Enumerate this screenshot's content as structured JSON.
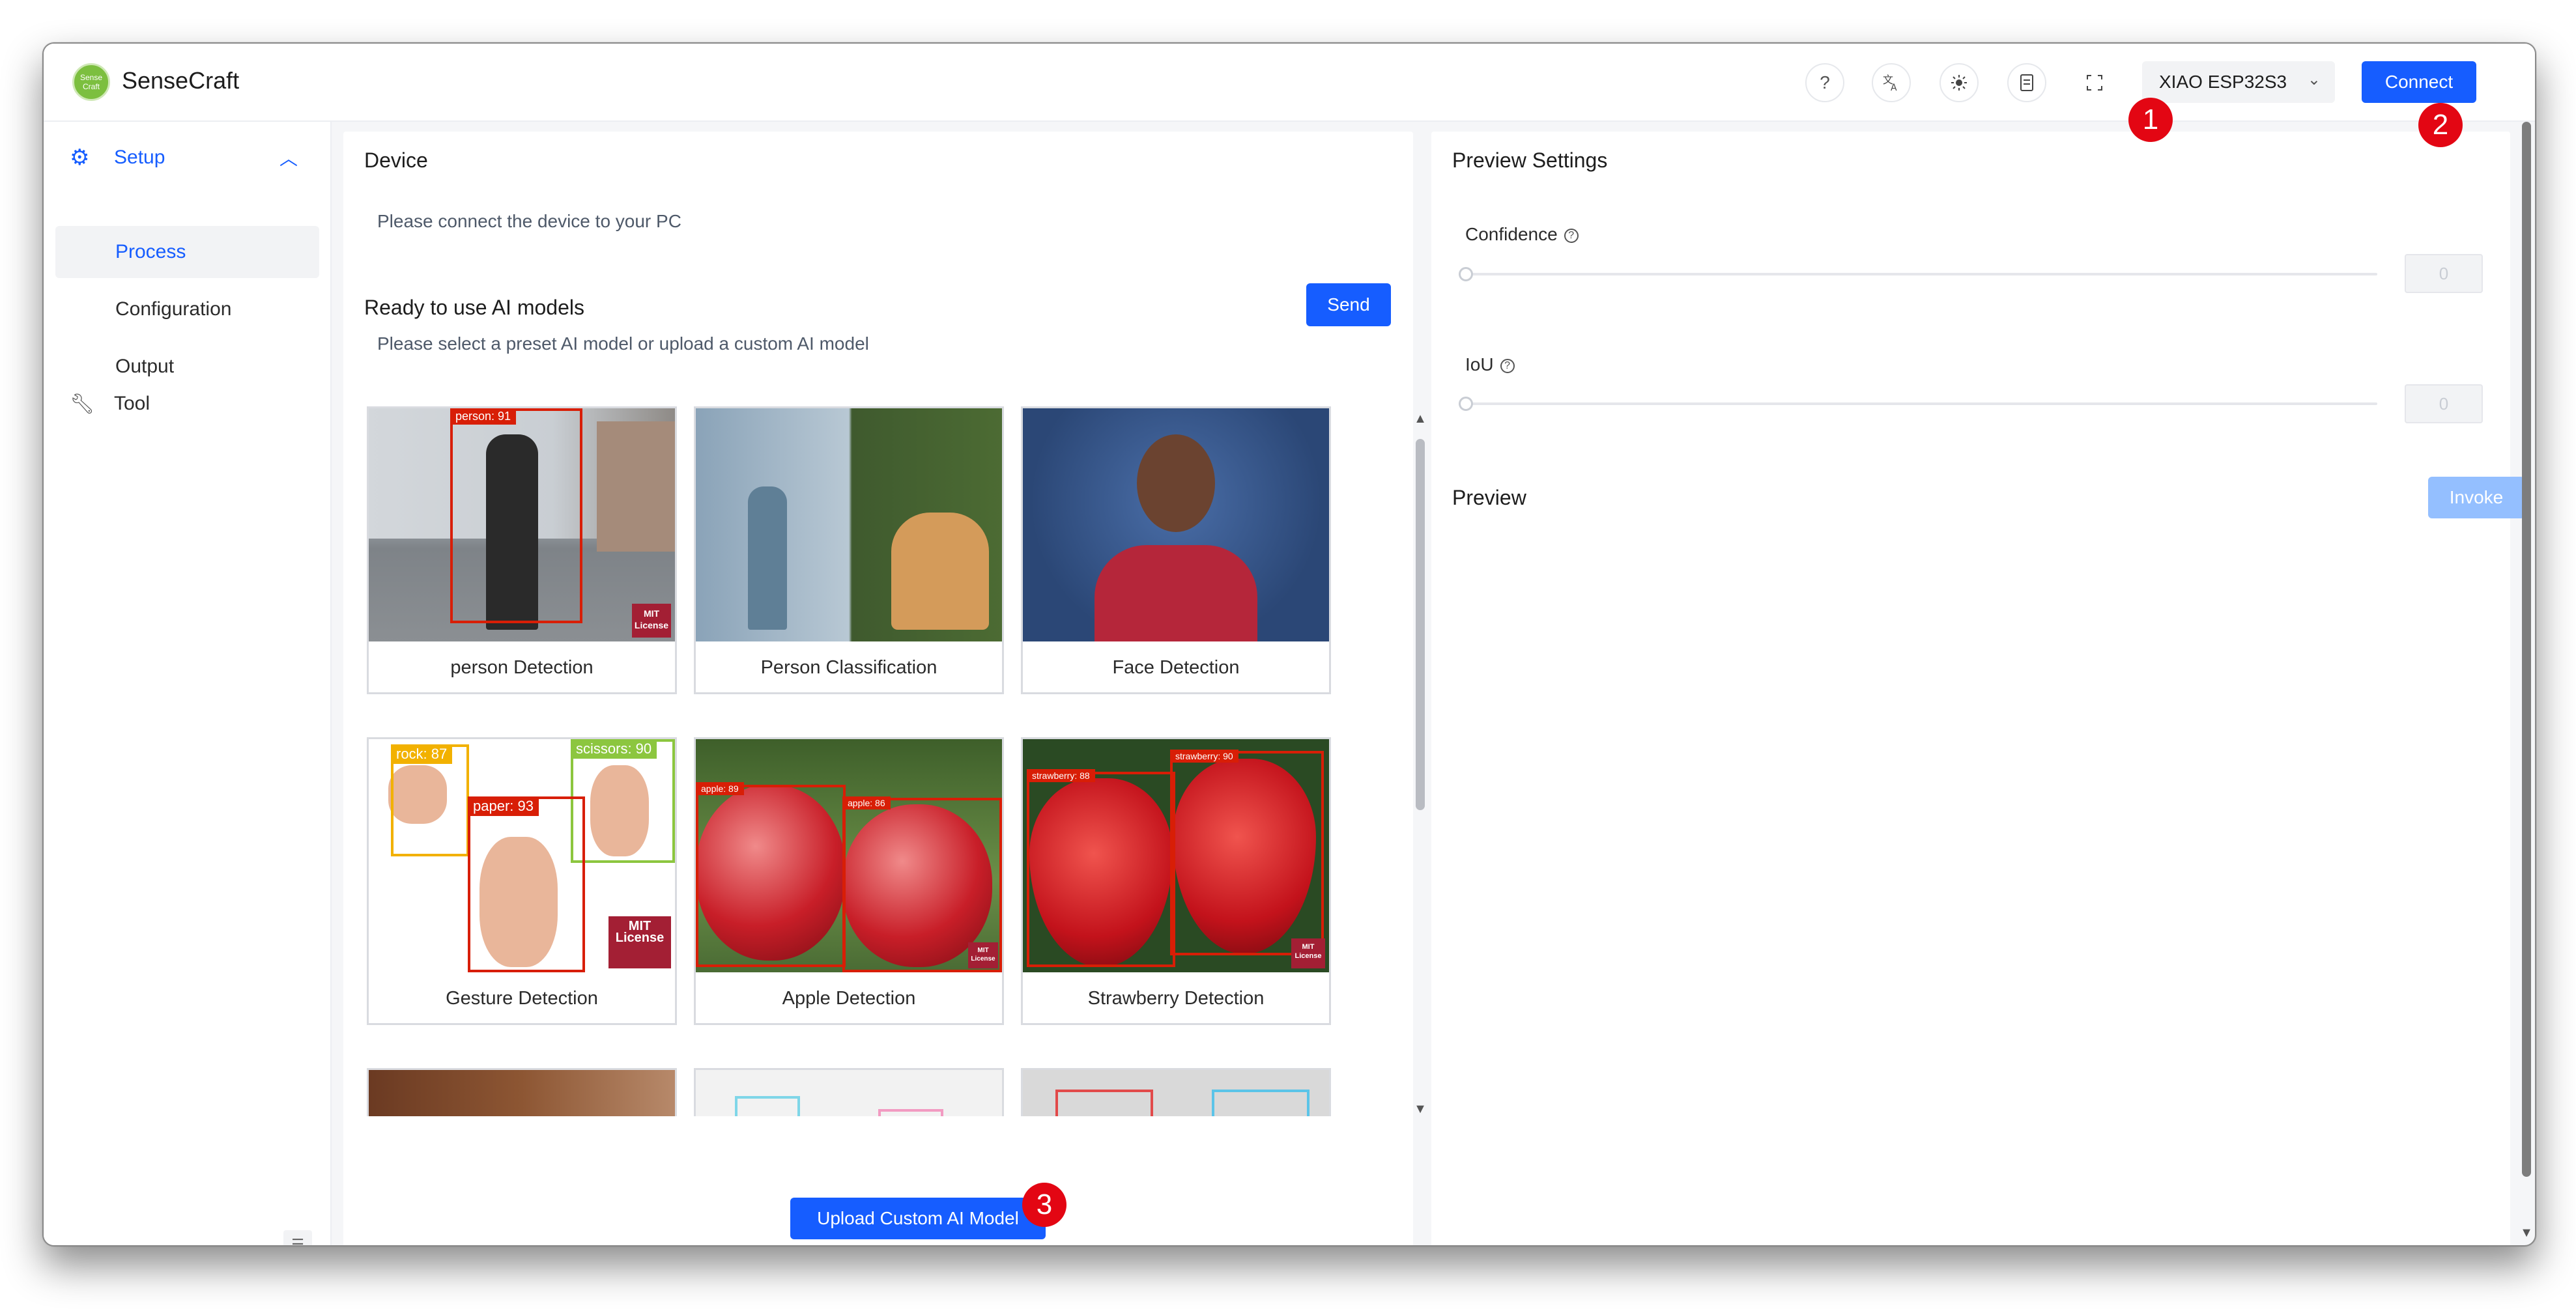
{
  "header": {
    "logo_text": "Sense Craft",
    "app_title": "SenseCraft",
    "device_select": "XIAO ESP32S3",
    "connect_label": "Connect"
  },
  "markers": [
    "1",
    "2",
    "3"
  ],
  "sidebar": {
    "group_label": "Setup",
    "items": [
      {
        "label": "Process"
      },
      {
        "label": "Configuration"
      },
      {
        "label": "Output"
      }
    ],
    "tool_label": "Tool"
  },
  "device": {
    "title": "Device",
    "message": "Please connect the device to your PC"
  },
  "models": {
    "title": "Ready to use AI models",
    "subtitle": "Please select a preset AI model or upload a custom AI model",
    "send_label": "Send",
    "cards": [
      {
        "label": "person Detection",
        "tags": [
          "person: 91"
        ]
      },
      {
        "label": "Person Classification",
        "tags": []
      },
      {
        "label": "Face Detection",
        "tags": []
      },
      {
        "label": "Gesture Detection",
        "tags": [
          "rock: 87",
          "scissors: 90",
          "paper: 93"
        ]
      },
      {
        "label": "Apple Detection",
        "tags": [
          "apple: 89",
          "apple: 86"
        ]
      },
      {
        "label": "Strawberry Detection",
        "tags": [
          "strawberry: 88",
          "strawberry: 90"
        ]
      }
    ],
    "license_text": "MIT License",
    "upload_label": "Upload Custom AI Model"
  },
  "preview_settings": {
    "title": "Preview Settings",
    "confidence_label": "Confidence",
    "confidence_value": "0",
    "iou_label": "IoU",
    "iou_value": "0"
  },
  "preview": {
    "title": "Preview",
    "invoke_label": "Invoke"
  },
  "colors": {
    "primary": "#165dff",
    "primary_disabled": "#94bfff",
    "marker": "#e30613",
    "detect_red": "#d81e06"
  }
}
